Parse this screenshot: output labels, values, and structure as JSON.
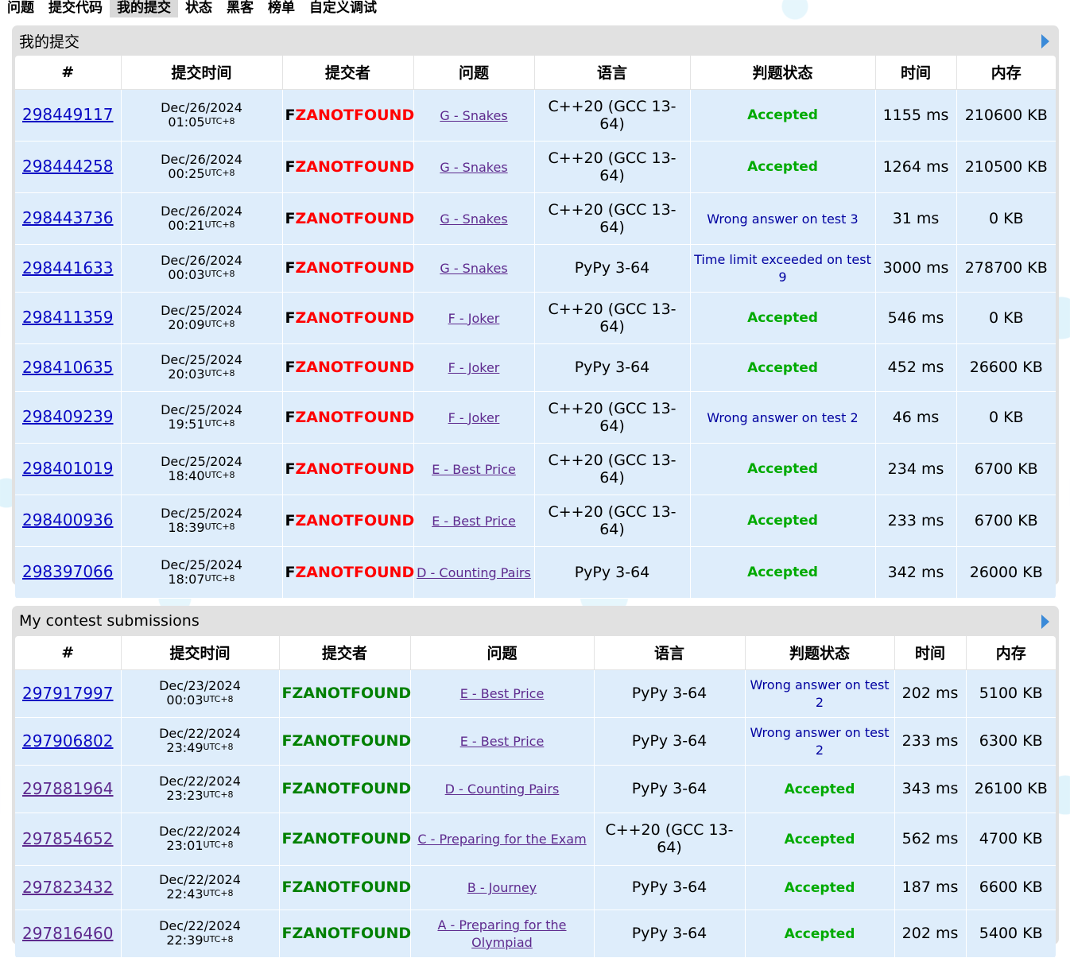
{
  "menu": [
    "问题",
    "提交代码",
    "我的提交",
    "状态",
    "黑客",
    "榜单",
    "自定义调试"
  ],
  "menu_active": 2,
  "p1": {
    "title": "我的提交",
    "headers": [
      "#",
      "提交时间",
      "提交者",
      "问题",
      "语言",
      "判题状态",
      "时间",
      "内存"
    ],
    "rows": [
      {
        "id": "298449117",
        "date": "Dec/26/2024",
        "time": "01:05",
        "tz": "UTC+8",
        "user_first": "F",
        "user_rest": "ZANOTFOUND",
        "problem": "G - Snakes",
        "lang": "C++20 (GCC 13-64)",
        "verdict": "Accepted",
        "ok": true,
        "ms": "1155 ms",
        "mem": "210600 KB"
      },
      {
        "id": "298444258",
        "date": "Dec/26/2024",
        "time": "00:25",
        "tz": "UTC+8",
        "user_first": "F",
        "user_rest": "ZANOTFOUND",
        "problem": "G - Snakes",
        "lang": "C++20 (GCC 13-64)",
        "verdict": "Accepted",
        "ok": true,
        "ms": "1264 ms",
        "mem": "210500 KB"
      },
      {
        "id": "298443736",
        "date": "Dec/26/2024",
        "time": "00:21",
        "tz": "UTC+8",
        "user_first": "F",
        "user_rest": "ZANOTFOUND",
        "problem": "G - Snakes",
        "lang": "C++20 (GCC 13-64)",
        "verdict": "Wrong answer on test 3",
        "ok": false,
        "ms": "31 ms",
        "mem": "0 KB"
      },
      {
        "id": "298441633",
        "date": "Dec/26/2024",
        "time": "00:03",
        "tz": "UTC+8",
        "user_first": "F",
        "user_rest": "ZANOTFOUND",
        "problem": "G - Snakes",
        "lang": "PyPy 3-64",
        "verdict": "Time limit exceeded on test 9",
        "ok": false,
        "ms": "3000 ms",
        "mem": "278700 KB"
      },
      {
        "id": "298411359",
        "date": "Dec/25/2024",
        "time": "20:09",
        "tz": "UTC+8",
        "user_first": "F",
        "user_rest": "ZANOTFOUND",
        "problem": "F - Joker",
        "lang": "C++20 (GCC 13-64)",
        "verdict": "Accepted",
        "ok": true,
        "ms": "546 ms",
        "mem": "0 KB"
      },
      {
        "id": "298410635",
        "date": "Dec/25/2024",
        "time": "20:03",
        "tz": "UTC+8",
        "user_first": "F",
        "user_rest": "ZANOTFOUND",
        "problem": "F - Joker",
        "lang": "PyPy 3-64",
        "verdict": "Accepted",
        "ok": true,
        "ms": "452 ms",
        "mem": "26600 KB"
      },
      {
        "id": "298409239",
        "date": "Dec/25/2024",
        "time": "19:51",
        "tz": "UTC+8",
        "user_first": "F",
        "user_rest": "ZANOTFOUND",
        "problem": "F - Joker",
        "lang": "C++20 (GCC 13-64)",
        "verdict": "Wrong answer on test 2",
        "ok": false,
        "ms": "46 ms",
        "mem": "0 KB"
      },
      {
        "id": "298401019",
        "date": "Dec/25/2024",
        "time": "18:40",
        "tz": "UTC+8",
        "user_first": "F",
        "user_rest": "ZANOTFOUND",
        "problem": "E - Best Price",
        "lang": "C++20 (GCC 13-64)",
        "verdict": "Accepted",
        "ok": true,
        "ms": "234 ms",
        "mem": "6700 KB"
      },
      {
        "id": "298400936",
        "date": "Dec/25/2024",
        "time": "18:39",
        "tz": "UTC+8",
        "user_first": "F",
        "user_rest": "ZANOTFOUND",
        "problem": "E - Best Price",
        "lang": "C++20 (GCC 13-64)",
        "verdict": "Accepted",
        "ok": true,
        "ms": "233 ms",
        "mem": "6700 KB"
      },
      {
        "id": "298397066",
        "date": "Dec/25/2024",
        "time": "18:07",
        "tz": "UTC+8",
        "user_first": "F",
        "user_rest": "ZANOTFOUND",
        "problem": "D - Counting Pairs",
        "lang": "PyPy 3-64",
        "verdict": "Accepted",
        "ok": true,
        "ms": "342 ms",
        "mem": "26000 KB"
      }
    ]
  },
  "p2": {
    "title": "My contest submissions",
    "headers": [
      "#",
      "提交时间",
      "提交者",
      "问题",
      "语言",
      "判题状态",
      "时间",
      "内存"
    ],
    "rows": [
      {
        "id": "297917997",
        "date": "Dec/23/2024",
        "time": "00:03",
        "tz": "UTC+8",
        "user": "FZANOTFOUND",
        "problem": "E - Best Price",
        "lang": "PyPy 3-64",
        "verdict": "Wrong answer on test 2",
        "ok": false,
        "ms": "202 ms",
        "mem": "5100 KB"
      },
      {
        "id": "297906802",
        "date": "Dec/22/2024",
        "time": "23:49",
        "tz": "UTC+8",
        "user": "FZANOTFOUND",
        "problem": "E - Best Price",
        "lang": "PyPy 3-64",
        "verdict": "Wrong answer on test 2",
        "ok": false,
        "ms": "233 ms",
        "mem": "6300 KB"
      },
      {
        "id": "297881964",
        "date": "Dec/22/2024",
        "time": "23:23",
        "tz": "UTC+8",
        "user": "FZANOTFOUND",
        "problem": "D - Counting Pairs",
        "lang": "PyPy 3-64",
        "verdict": "Accepted",
        "ok": true,
        "ms": "343 ms",
        "mem": "26100 KB"
      },
      {
        "id": "297854652",
        "date": "Dec/22/2024",
        "time": "23:01",
        "tz": "UTC+8",
        "user": "FZANOTFOUND",
        "problem": "C - Preparing for the Exam",
        "lang": "C++20 (GCC 13-64)",
        "verdict": "Accepted",
        "ok": true,
        "ms": "562 ms",
        "mem": "4700 KB"
      },
      {
        "id": "297823432",
        "date": "Dec/22/2024",
        "time": "22:43",
        "tz": "UTC+8",
        "user": "FZANOTFOUND",
        "problem": "B - Journey",
        "lang": "PyPy 3-64",
        "verdict": "Accepted",
        "ok": true,
        "ms": "187 ms",
        "mem": "6600 KB"
      },
      {
        "id": "297816460",
        "date": "Dec/22/2024",
        "time": "22:39",
        "tz": "UTC+8",
        "user": "FZANOTFOUND",
        "problem": "A - Preparing for the Olympiad",
        "lang": "PyPy 3-64",
        "verdict": "Accepted",
        "ok": true,
        "ms": "202 ms",
        "mem": "5400 KB"
      }
    ]
  },
  "colors": {
    "accepted": "#00aa00",
    "verdict_other": "#0000a0",
    "row_bg": "#deedfb",
    "panel_bg": "#e1e1e1",
    "user_red": "#ff0000",
    "user_green": "#008000"
  }
}
